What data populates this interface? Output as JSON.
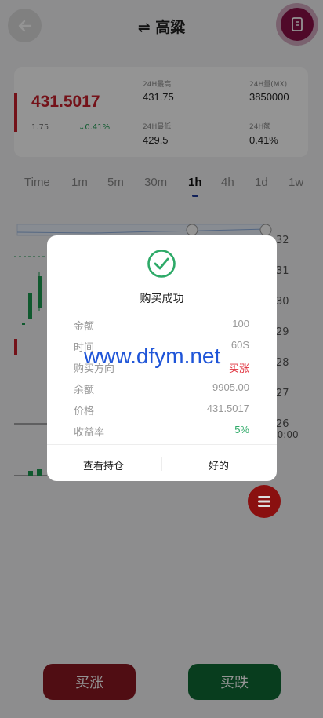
{
  "header": {
    "title": "高粱"
  },
  "price": {
    "current": "431.5017",
    "small": "1.75",
    "change": "0.41%",
    "high_label": "24H最高",
    "high_value": "431.75",
    "volume_label": "24H量(MX)",
    "volume_value": "3850000",
    "low_label": "24H最低",
    "low_value": "429.5",
    "amount_label": "24H额",
    "amount_value": "0.41%"
  },
  "tabs": [
    "Time",
    "1m",
    "5m",
    "30m",
    "1h",
    "4h",
    "1d",
    "1w"
  ],
  "active_tab": "1h",
  "chart": {
    "axis_labels": [
      "32",
      "31",
      "30",
      "29",
      "28",
      "27",
      "26",
      "00:00"
    ]
  },
  "dialog": {
    "title": "购买成功",
    "rows": [
      {
        "label": "金额",
        "value": "100"
      },
      {
        "label": "时间",
        "value": "60S"
      },
      {
        "label": "购买方向",
        "value": "买涨"
      },
      {
        "label": "余额",
        "value": "9905.00"
      },
      {
        "label": "价格",
        "value": "431.5017"
      },
      {
        "label": "收益率",
        "value": "5%"
      }
    ],
    "btn_positions": "查看持仓",
    "btn_ok": "好的"
  },
  "actions": {
    "buy_up": "买涨",
    "buy_down": "买跌"
  },
  "watermark": "www.dfym.net",
  "colors": {
    "up": "#c8202c",
    "down": "#1a9a50",
    "accent": "#8a1048"
  }
}
